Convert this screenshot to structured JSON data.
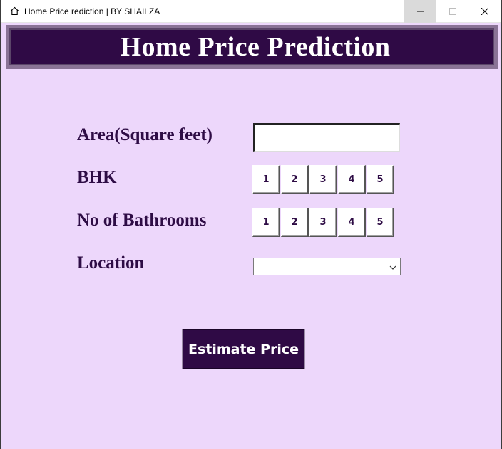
{
  "window": {
    "title": "Home Price rediction | BY SHAILZA",
    "app_icon": "home-icon"
  },
  "header": {
    "title": "Home Price Prediction"
  },
  "form": {
    "area_label": "Area(Square feet)",
    "area_value": "",
    "bhk_label": "BHK",
    "bhk_options": [
      "1",
      "2",
      "3",
      "4",
      "5"
    ],
    "bath_label": "No of Bathrooms",
    "bath_options": [
      "1",
      "2",
      "3",
      "4",
      "5"
    ],
    "location_label": "Location",
    "location_value": ""
  },
  "actions": {
    "estimate_label": "Estimate Price"
  },
  "colors": {
    "background": "#edd7fb",
    "accent": "#2f0a45",
    "label_text": "#2e0c45"
  }
}
